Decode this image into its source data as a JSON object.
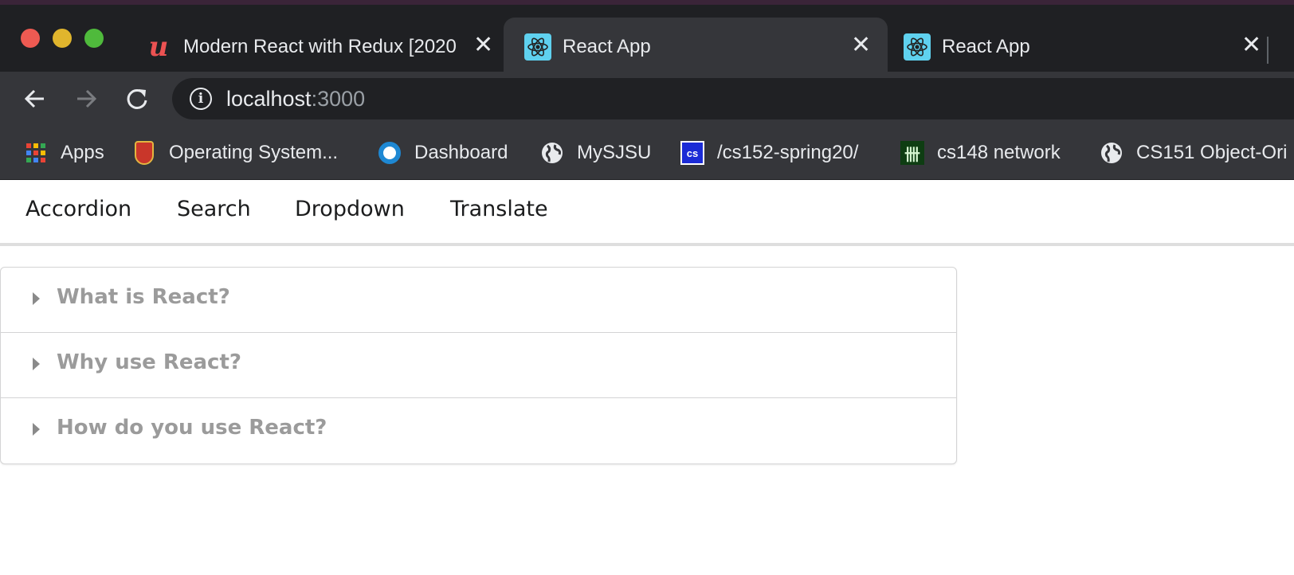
{
  "browser": {
    "tabs": [
      {
        "title": "Modern React with Redux [2020",
        "favicon": "udemy-icon",
        "active": false
      },
      {
        "title": "React App",
        "favicon": "react-icon",
        "active": true
      },
      {
        "title": "React App",
        "favicon": "react-icon",
        "active": false
      }
    ],
    "close_glyph": "✕",
    "address": {
      "host": "localhost",
      "port": ":3000"
    },
    "bookmarks": [
      {
        "label": "Apps",
        "icon": "apps-grid-icon"
      },
      {
        "label": "Operating System...",
        "icon": "crest-icon"
      },
      {
        "label": "Dashboard",
        "icon": "dashboard-icon"
      },
      {
        "label": "MySJSU",
        "icon": "globe-icon"
      },
      {
        "label": "/cs152-spring20/",
        "icon": "cs-icon"
      },
      {
        "label": "cs148 network",
        "icon": "network-icon"
      },
      {
        "label": "CS151 Object-Ori",
        "icon": "globe-icon"
      }
    ],
    "colors": {
      "tabstrip": "#1f2023",
      "toolbar": "#35363a",
      "omnibox": "#202124",
      "react_blue": "#5fd1ef"
    }
  },
  "app": {
    "menu": [
      {
        "label": "Accordion"
      },
      {
        "label": "Search"
      },
      {
        "label": "Dropdown"
      },
      {
        "label": "Translate"
      }
    ],
    "accordion": [
      {
        "title": "What is React?",
        "expanded": false
      },
      {
        "title": "Why use React?",
        "expanded": false
      },
      {
        "title": "How do you use React?",
        "expanded": false
      }
    ]
  }
}
